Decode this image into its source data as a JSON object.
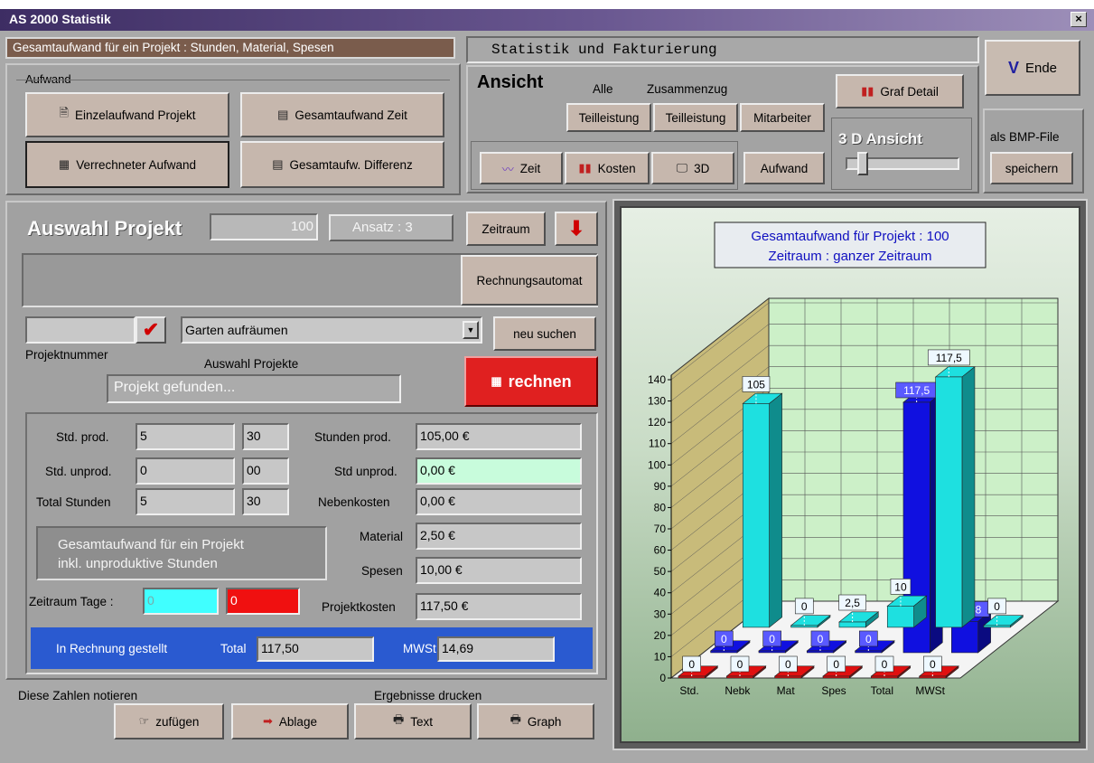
{
  "top_strip": "      ",
  "window": {
    "title": "AS 2000   Statistik",
    "close": "×"
  },
  "header_info": "Gesamtaufwand für ein Projekt : Stunden, Material, Spesen",
  "header_title": "Statistik  und  Fakturierung",
  "aufwand": {
    "group": "Aufwand",
    "b1": "Einzelaufwand Projekt",
    "b2": "Gesamtaufwand Zeit",
    "b3": "Verrechneter Aufwand",
    "b4": "Gesamtaufw. Differenz"
  },
  "ansicht": {
    "title": "Ansicht",
    "alle": "Alle",
    "zusammenzug": "Zusammenzug",
    "tl1": "Teilleistung",
    "tl2": "Teilleistung",
    "mitarbeiter": "Mitarbeiter",
    "zeit": "Zeit",
    "kosten": "Kosten",
    "d3": "3D",
    "aufwand": "Aufwand",
    "graf_detail": "Graf Detail",
    "ansicht3d": "3 D Ansicht",
    "slider_level": 0.1
  },
  "ende": "Ende",
  "bmp": {
    "label": "als BMP-File",
    "button": "speichern"
  },
  "projekt": {
    "title": "Auswahl Projekt",
    "number": "100",
    "ansatz": "Ansatz : 3",
    "zeitraum": "Zeitraum",
    "rechnungsautomat": "Rechnungsautomat",
    "nummer_value": "",
    "dropdown": "Garten aufräumen",
    "neu_suchen": "neu suchen",
    "projektnummer_label": "Projektnummer",
    "auswahl_label": "Auswahl Projekte",
    "status": "Projekt gefunden...",
    "rechnen": "rechnen"
  },
  "figures": {
    "std_prod_label": "Std. prod.",
    "std_prod_h": "5",
    "std_prod_m": "30",
    "std_unprod_label": "Std. unprod.",
    "std_unprod_h": "0",
    "std_unprod_m": "00",
    "total_label": "Total Stunden",
    "total_h": "5",
    "total_m": "30",
    "stunden_prod_label": "Stunden prod.",
    "stunden_prod": "105,00 €",
    "std_unprod_cost_label": "Std unprod.",
    "std_unprod_cost": "0,00 €",
    "nebenkosten_label": "Nebenkosten",
    "nebenkosten": "0,00 €",
    "material_label": "Material",
    "material": "2,50 €",
    "spesen_label": "Spesen",
    "spesen": "10,00 €",
    "projektkosten_label": "Projektkosten",
    "projektkosten": "117,50 €",
    "gesamt_text1": "Gesamtaufwand für ein Projekt",
    "gesamt_text2": "inkl. unproduktive Stunden",
    "zeitraum_label": "Zeitraum Tage :",
    "zeitraum_a": "0",
    "zeitraum_b": "0",
    "rechnung_label": "In Rechnung gestellt",
    "total_label2": "Total",
    "total_value": "117,50",
    "mwst_label": "MWSt",
    "mwst_value": "14,69"
  },
  "bottom": {
    "notieren": "Diese Zahlen notieren",
    "drucken": "Ergebnisse drucken",
    "zufuegen": "zufügen",
    "ablage": "Ablage",
    "text": "Text",
    "graph": "Graph"
  },
  "chart_data": {
    "type": "bar",
    "title": "Gesamtaufwand für Projekt : 100",
    "subtitle": "Zeitraum : ganzer Zeitraum",
    "categories": [
      "Std.",
      "Nebk",
      "Mat",
      "Spes",
      "Total",
      "MWSt"
    ],
    "ylim": [
      0,
      140
    ],
    "yticks": [
      "0",
      "10",
      "20",
      "30",
      "40",
      "50",
      "60",
      "70",
      "80",
      "90",
      "100",
      "110",
      "120",
      "130",
      "140"
    ],
    "series": [
      {
        "values": [
          105,
          0,
          2.5,
          10,
          117.5,
          0
        ],
        "labels": [
          "105",
          "0",
          "2,5",
          "10",
          "117,5",
          "0"
        ],
        "color": "#1ee0e0"
      },
      {
        "values": [
          0,
          0,
          0,
          0,
          117.5,
          14.688
        ],
        "labels": [
          "0",
          "0",
          "0",
          "0",
          "117,5",
          "14,688"
        ],
        "color": "#1010e0"
      },
      {
        "values": [
          0,
          0,
          0,
          0,
          0,
          0
        ],
        "labels": [
          "0",
          "0",
          "0",
          "0",
          "0",
          "0"
        ],
        "color": "#e01010"
      }
    ]
  }
}
